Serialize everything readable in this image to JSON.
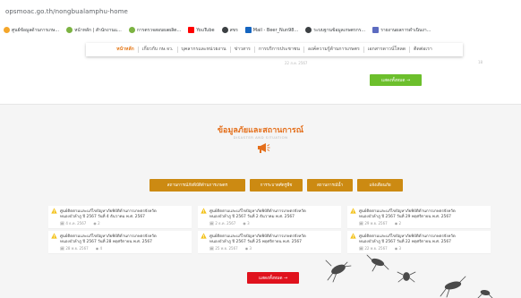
{
  "browser": {
    "url": "opsmoac.go.th/nongbualamphu-home",
    "bookmarks": [
      {
        "label": "ศูนย์ข้อมูลด้านการเกษ...",
        "color": "#f4a62a"
      },
      {
        "label": "หน้าหลัก | สำนักงานแ...",
        "color": "#7cb342"
      },
      {
        "label": "การตรวจสอบผลผลิต...",
        "color": "#7cb342"
      },
      {
        "label": "YouTube",
        "color": "#ff0000"
      },
      {
        "label": "สขร",
        "color": "#3c4043"
      },
      {
        "label": "Mail - Beer_Nun98...",
        "color": "#1565c0"
      },
      {
        "label": "ระบบฐานข้อมูลเกษตรกร...",
        "color": "#3c4043"
      },
      {
        "label": "รายงานผลการดำเนินงา...",
        "color": "#5c6bc0"
      }
    ]
  },
  "nav": {
    "items": [
      "หน้าหลัก",
      "เกี่ยวกับ กษ.จว.",
      "บุคลากรและหน่วยงาน",
      "ข่าวสาร",
      "การบริการประชาชน",
      "องค์ความรู้ด้านการเกษตร",
      "เอกสารดาวน์โหลด",
      "ติดต่อเรา"
    ],
    "active_index": 0
  },
  "top": {
    "faint_date": "22 ส.ค. 2567",
    "faint_views": "18",
    "more_button": "แสดงทั้งหมด →"
  },
  "disaster": {
    "title": "ข้อมูลภัยและสถานการณ์",
    "subtitle": "DISASTER AND SITUATION",
    "categories": [
      "สถานการณ์ภัยพิบัติด้านการเกษตร",
      "การระบาดศัตรูพืช",
      "สถานการณ์น้ำ",
      "แจ้งเตือนภัย"
    ],
    "cards": [
      {
        "line1": "ศูนย์ติดตามและแก้ไขปัญหาภัยพิบัติด้านการเกษตรจังหวัด",
        "line2": "หนองบัวลำภู ปี 2567 วันที่ 4 ธันวาคม พ.ศ. 2567",
        "date": "4 ธ.ค. 2567",
        "views": "2"
      },
      {
        "line1": "ศูนย์ติดตามและแก้ไขปัญหาภัยพิบัติด้านการเกษตรจังหวัด",
        "line2": "หนองบัวลำภู ปี 2567 วันที่ 2 ธันวาคม พ.ศ. 2567",
        "date": "2 ธ.ค. 2567",
        "views": "3"
      },
      {
        "line1": "ศูนย์ติดตามและแก้ไขปัญหาภัยพิบัติด้านการเกษตรจังหวัด",
        "line2": "หนองบัวลำภู ปี 2567 วันที่ 29 พฤศจิกายน พ.ศ. 2567",
        "date": "29 พ.ย. 2567",
        "views": "2"
      },
      {
        "line1": "ศูนย์ติดตามและแก้ไขปัญหาภัยพิบัติด้านการเกษตรจังหวัด",
        "line2": "หนองบัวลำภู ปี 2567 วันที่ 28 พฤศจิกายน พ.ศ. 2567",
        "date": "28 พ.ย. 2567",
        "views": "4"
      },
      {
        "line1": "ศูนย์ติดตามและแก้ไขปัญหาภัยพิบัติด้านการเกษตรจังหวัด",
        "line2": "หนองบัวลำภู ปี 2567 วันที่ 25 พฤศจิกายน พ.ศ. 2567",
        "date": "25 พ.ย. 2567",
        "views": "3"
      },
      {
        "line1": "ศูนย์ติดตามและแก้ไขปัญหาภัยพิบัติด้านการเกษตรจังหวัด",
        "line2": "หนองบัวลำภู ปี 2567 วันที่ 22 พฤศจิกายน พ.ศ. 2567",
        "date": "22 พ.ย. 2567",
        "views": "3"
      }
    ],
    "more_button": "แสดงทั้งหมด →"
  },
  "colors": {
    "accent_orange": "#e46f1b",
    "category_gold": "#cc8a12",
    "green_button": "#6cbf2c",
    "red_button": "#e0121d",
    "warning_yellow": "#f3c21b"
  },
  "icons": {
    "megaphone": "megaphone-icon",
    "warning": "warning-triangle-icon",
    "calendar": "calendar-icon",
    "views": "eye-icon"
  }
}
